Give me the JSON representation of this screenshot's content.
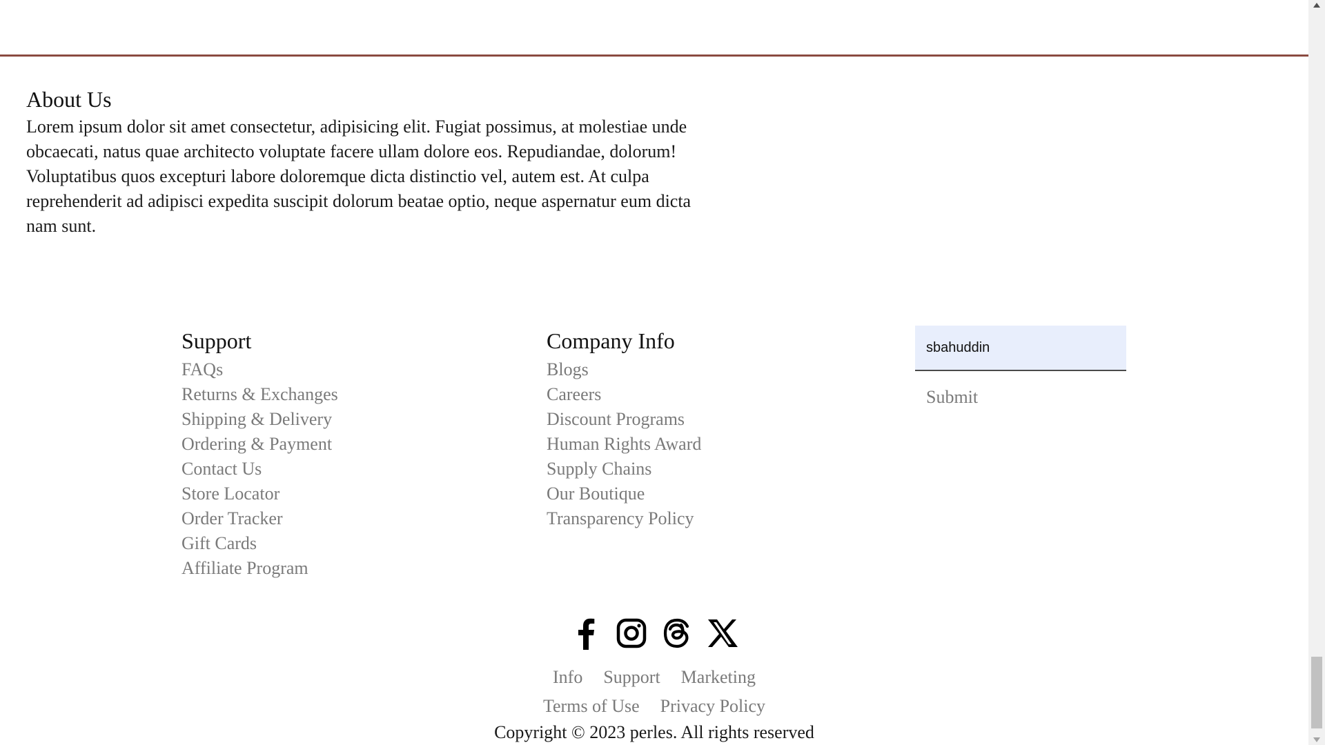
{
  "colors": {
    "divider": "#8b4a40",
    "link": "#7a7a7a",
    "heading": "#111111",
    "input_bg": "#e8eefc"
  },
  "about": {
    "title": "About Us",
    "body": "Lorem ipsum dolor sit amet consectetur, adipisicing elit. Fugiat possimus, at molestiae unde obcaecati, natus quae architecto voluptate facere ullam dolore eos. Repudiandae, dolorum! Voluptatibus quos excepturi labore doloremque dicta distinctio vel, autem est. At culpa reprehenderit ad adipisci expedita suscipit dolorum beatae optio, neque aspernatur eum dicta nam sunt."
  },
  "support": {
    "title": "Support",
    "items": [
      "FAQs",
      "Returns & Exchanges",
      "Shipping & Delivery",
      "Ordering & Payment",
      "Contact Us",
      "Store Locator",
      "Order Tracker",
      "Gift Cards",
      "Affiliate Program"
    ]
  },
  "company": {
    "title": "Company Info",
    "items": [
      "Blogs",
      "Careers",
      "Discount Programs",
      "Human Rights Award",
      "Supply Chains",
      "Our Boutique",
      "Transparency Policy"
    ]
  },
  "newsletter": {
    "input_value": "sbahuddin",
    "submit_label": "Submit"
  },
  "social": {
    "icons": [
      "facebook-icon",
      "instagram-icon",
      "threads-icon",
      "x-icon"
    ]
  },
  "footer": {
    "links_row1": [
      "Info",
      "Support",
      "Marketing"
    ],
    "links_row2": [
      "Terms of Use",
      "Privacy Policy"
    ],
    "copyright": "Copyright © 2023 perles. All rights reserved"
  }
}
